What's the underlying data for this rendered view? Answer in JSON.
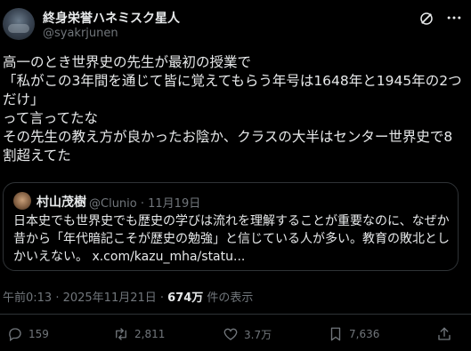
{
  "author": {
    "display_name": "終身栄誉ハネミスク星人",
    "handle": "@syakrjunen"
  },
  "tweet": {
    "lines": [
      "高一のとき世界史の先生が最初の授業で",
      "「私がこの3年間を通じて皆に覚えてもらう年号は1648年と1945年の2つ",
      "だけ」",
      "って言ってたな",
      "その先生の教え方が良かったお陰か、クラスの大半はセンター世界史で8",
      "割超えてた"
    ]
  },
  "quote": {
    "display_name": "村山茂樹",
    "handle_date": "@Clunio · 11月19日",
    "lines": [
      "日本史でも世界史でも歴史の学びは流れを理解することが重要なのに、なぜか",
      "昔から「年代暗記こそが歴史の勉強」と信じている人が多い。教育の敗北とし",
      "かいえない。 x.com/kazu_mha/statu..."
    ]
  },
  "meta": {
    "time_date": "午前0:13 · 2025年11月21日 · ",
    "views_count": "674万",
    "views_suffix": " 件の表示"
  },
  "actions": {
    "reply_count": "159",
    "repost_count": "2,811",
    "like_count": "3.7万",
    "bookmark_count": "7,636"
  }
}
